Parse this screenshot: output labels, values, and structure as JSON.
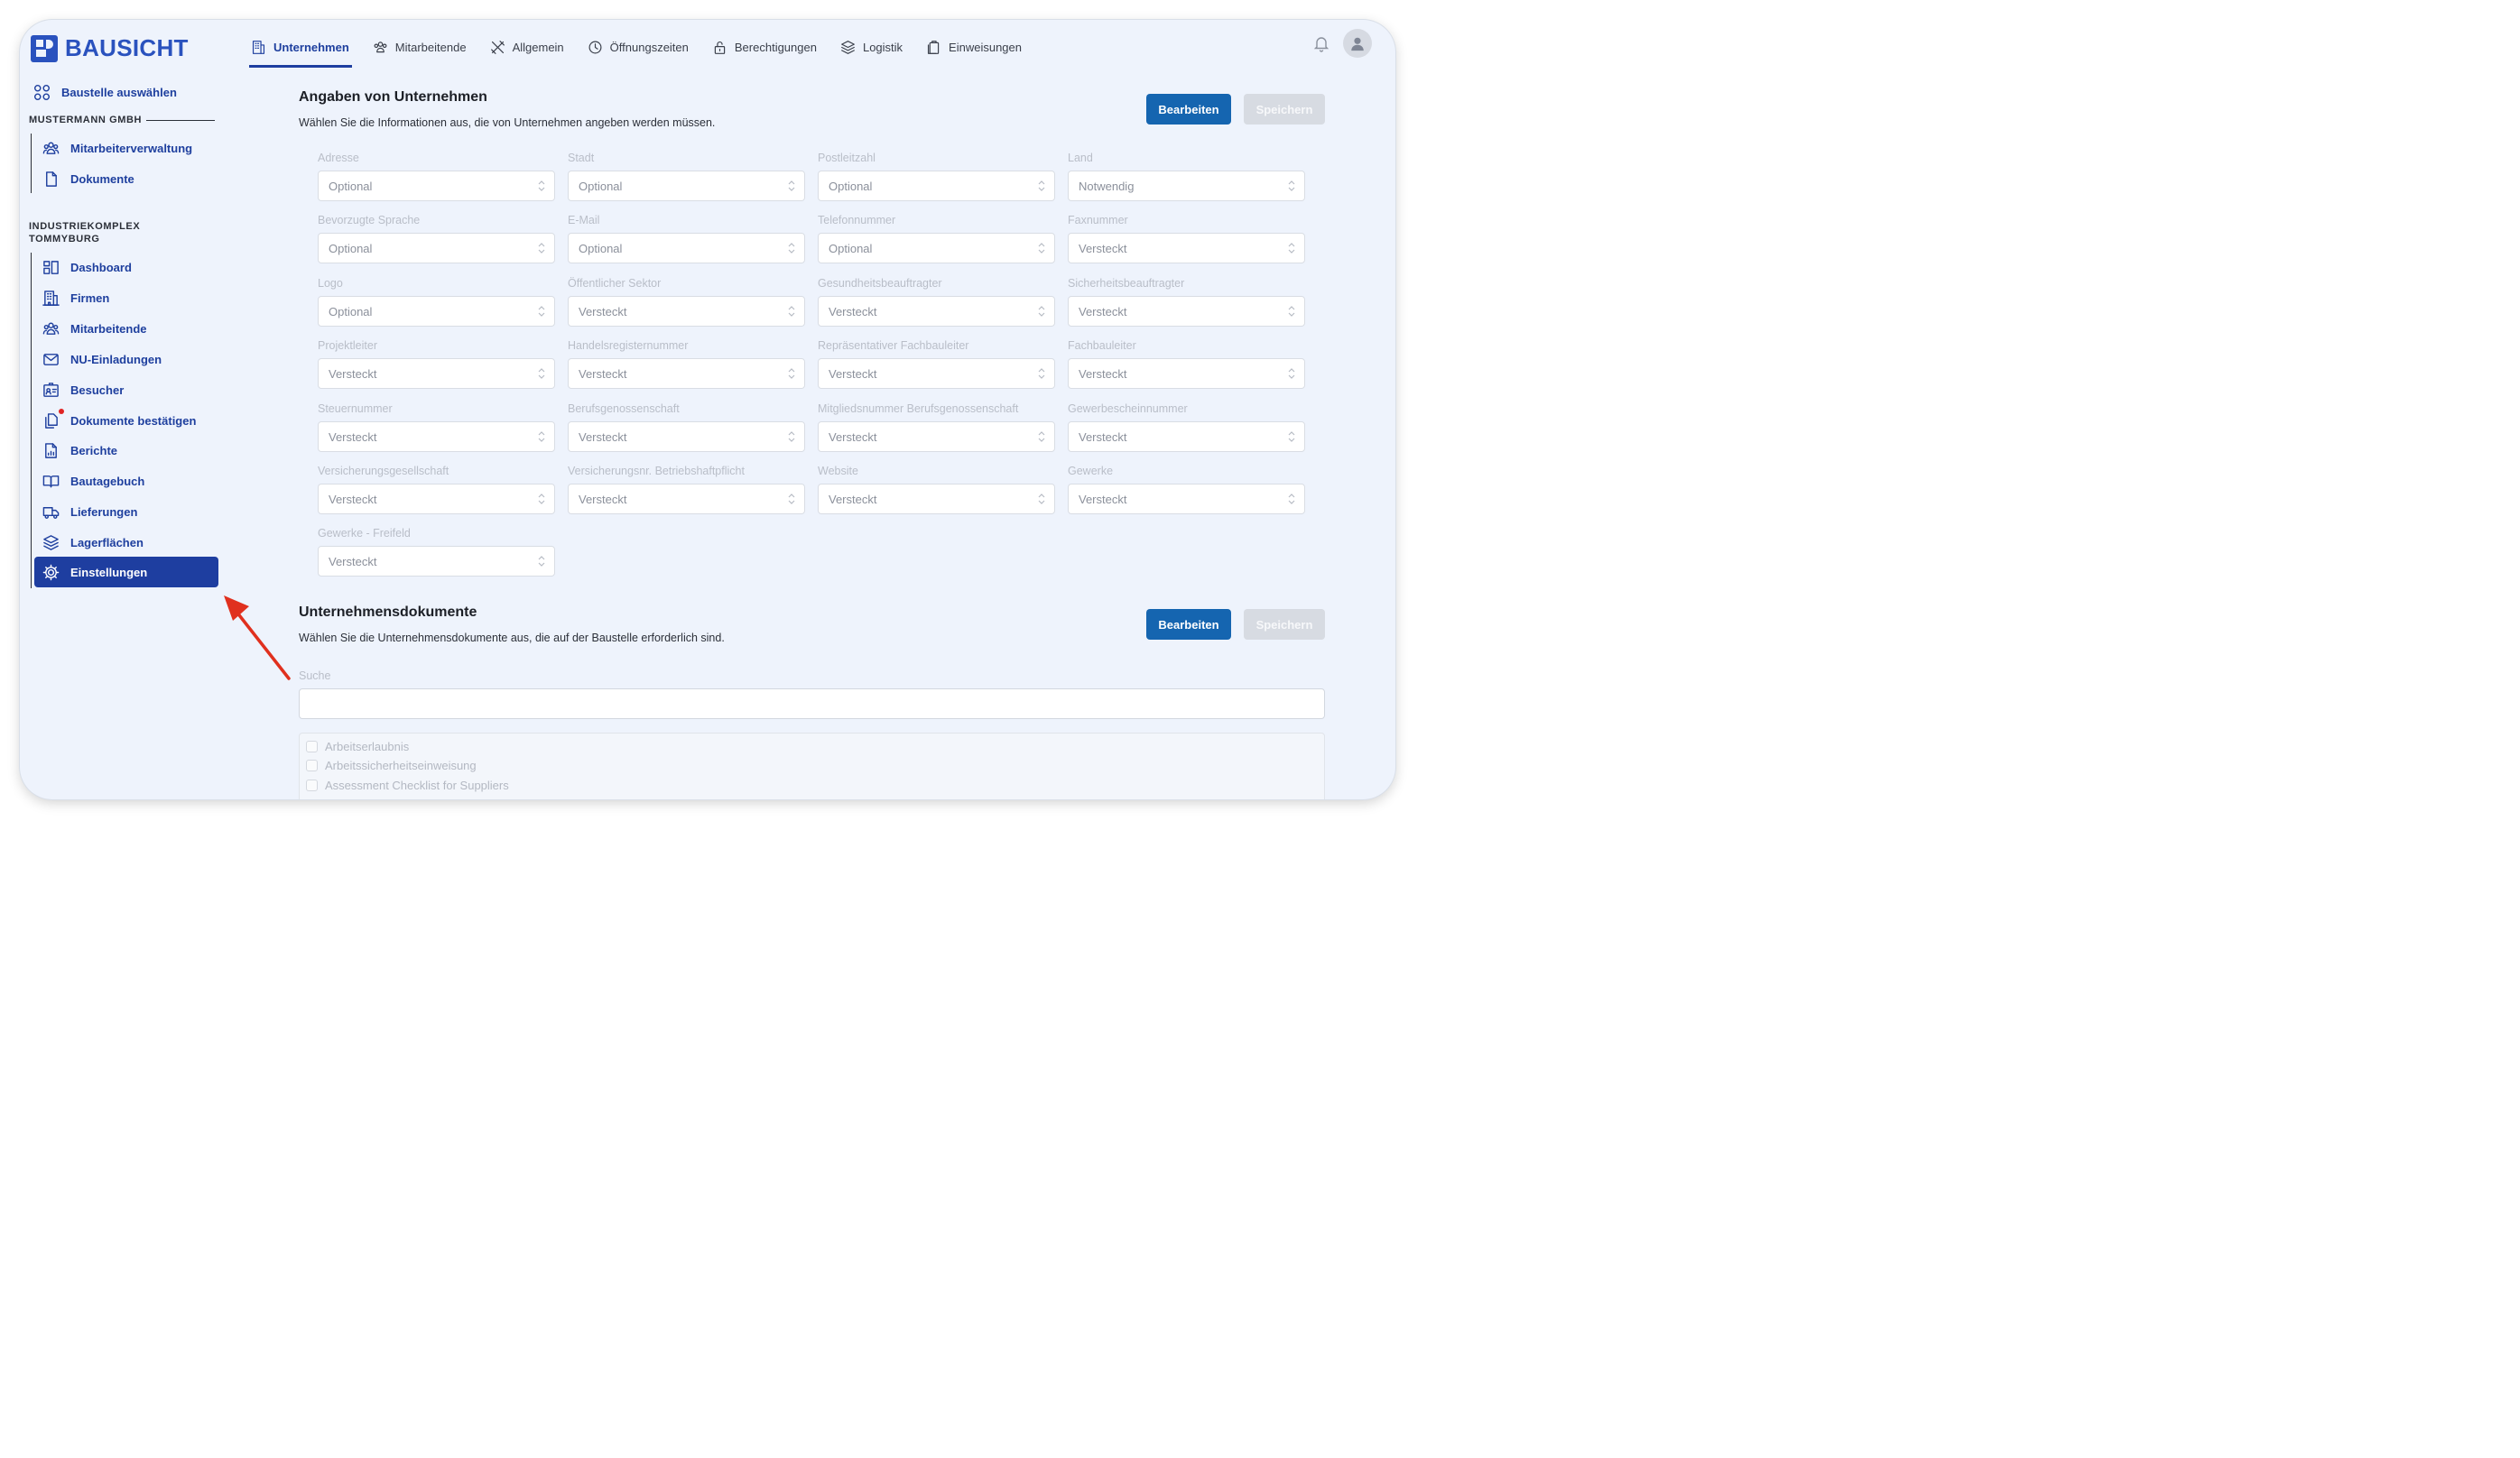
{
  "app": {
    "logo_text": "BAUSICHT"
  },
  "sidebar": {
    "top_link": "Baustelle auswählen",
    "group1_label": "MUSTERMANN GMBH",
    "group1_items": [
      {
        "label": "Mitarbeiterverwaltung",
        "icon": "users-icon"
      },
      {
        "label": "Dokumente",
        "icon": "document-icon"
      }
    ],
    "group2_label": "INDUSTRIEKOMPLEX TOMMYBURG",
    "group2_items": [
      {
        "label": "Dashboard",
        "icon": "dashboard-icon"
      },
      {
        "label": "Firmen",
        "icon": "building-icon"
      },
      {
        "label": "Mitarbeitende",
        "icon": "users-icon"
      },
      {
        "label": "NU-Einladungen",
        "icon": "mail-icon"
      },
      {
        "label": "Besucher",
        "icon": "id-card-icon"
      },
      {
        "label": "Dokumente bestätigen",
        "icon": "documents-icon"
      },
      {
        "label": "Berichte",
        "icon": "report-icon"
      },
      {
        "label": "Bautagebuch",
        "icon": "book-icon"
      },
      {
        "label": "Lieferungen",
        "icon": "truck-icon"
      },
      {
        "label": "Lagerflächen",
        "icon": "layers-icon"
      },
      {
        "label": "Einstellungen",
        "icon": "gear-icon",
        "active": true
      }
    ]
  },
  "tabs": [
    {
      "label": "Unternehmen",
      "active": true
    },
    {
      "label": "Mitarbeitende"
    },
    {
      "label": "Allgemein"
    },
    {
      "label": "Öffnungszeiten"
    },
    {
      "label": "Berechtigungen"
    },
    {
      "label": "Logistik"
    },
    {
      "label": "Einweisungen"
    }
  ],
  "section1": {
    "title": "Angaben von Unternehmen",
    "description": "Wählen Sie die Informationen aus, die von Unternehmen angeben werden müssen.",
    "edit_label": "Bearbeiten",
    "save_label": "Speichern",
    "fields": [
      {
        "label": "Adresse",
        "value": "Optional"
      },
      {
        "label": "Stadt",
        "value": "Optional"
      },
      {
        "label": "Postleitzahl",
        "value": "Optional"
      },
      {
        "label": "Land",
        "value": "Notwendig"
      },
      {
        "label": "Bevorzugte Sprache",
        "value": "Optional"
      },
      {
        "label": "E-Mail",
        "value": "Optional"
      },
      {
        "label": "Telefonnummer",
        "value": "Optional"
      },
      {
        "label": "Faxnummer",
        "value": "Versteckt"
      },
      {
        "label": "Logo",
        "value": "Optional"
      },
      {
        "label": "Öffentlicher Sektor",
        "value": "Versteckt"
      },
      {
        "label": "Gesundheitsbeauftragter",
        "value": "Versteckt"
      },
      {
        "label": "Sicherheitsbeauftragter",
        "value": "Versteckt"
      },
      {
        "label": "Projektleiter",
        "value": "Versteckt"
      },
      {
        "label": "Handelsregisternummer",
        "value": "Versteckt"
      },
      {
        "label": "Repräsentativer Fachbauleiter",
        "value": "Versteckt"
      },
      {
        "label": "Fachbauleiter",
        "value": "Versteckt"
      },
      {
        "label": "Steuernummer",
        "value": "Versteckt"
      },
      {
        "label": "Berufsgenossenschaft",
        "value": "Versteckt"
      },
      {
        "label": "Mitgliedsnummer Berufsgenossenschaft",
        "value": "Versteckt"
      },
      {
        "label": "Gewerbescheinnummer",
        "value": "Versteckt"
      },
      {
        "label": "Versicherungsgesellschaft",
        "value": "Versteckt"
      },
      {
        "label": "Versicherungsnr. Betriebshaftpflicht",
        "value": "Versteckt"
      },
      {
        "label": "Website",
        "value": "Versteckt"
      },
      {
        "label": "Gewerke",
        "value": "Versteckt"
      },
      {
        "label": "Gewerke - Freifeld",
        "value": "Versteckt"
      }
    ]
  },
  "section2": {
    "title": "Unternehmensdokumente",
    "description": "Wählen Sie die Unternehmensdokumente aus, die auf der Baustelle erforderlich sind.",
    "edit_label": "Bearbeiten",
    "save_label": "Speichern",
    "search_label": "Suche",
    "search_value": "",
    "documents": [
      "Arbeitserlaubnis",
      "Arbeitssicherheitseinweisung",
      "Assessment Checklist for Suppliers"
    ]
  },
  "colors": {
    "brand": "#2a52be",
    "active_nav": "#1e3ea0",
    "primary_button": "#1565b0",
    "annotation_arrow": "#e0301e"
  }
}
